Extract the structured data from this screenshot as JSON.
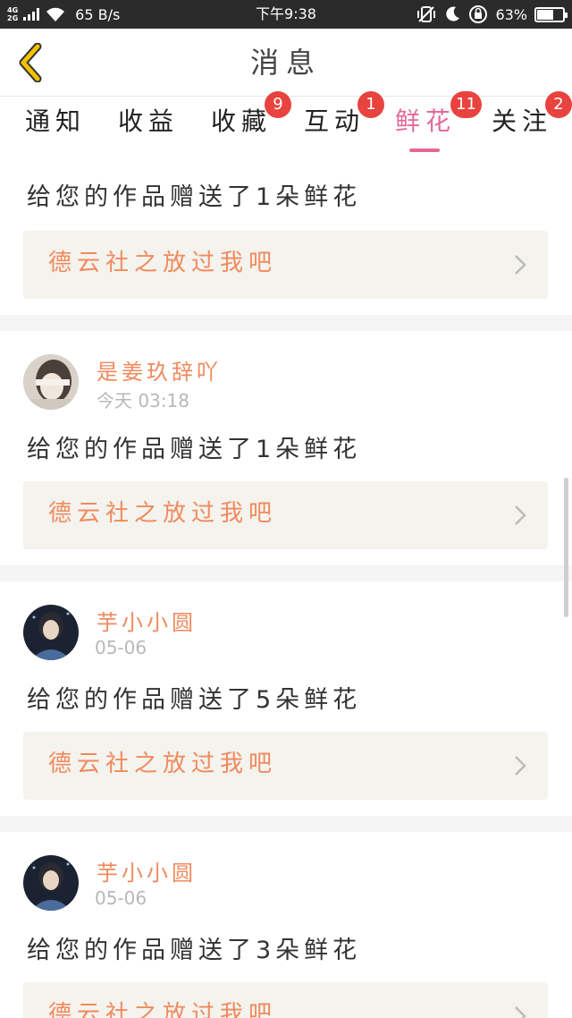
{
  "status_bar": {
    "network_top": "4G",
    "network_bottom": "2G",
    "speed": "65 B/s",
    "time": "下午9:38",
    "battery": "63%",
    "battery_level": 0.63
  },
  "header": {
    "title": "消息"
  },
  "tabs": [
    {
      "label": "通知",
      "badge": ""
    },
    {
      "label": "收益",
      "badge": ""
    },
    {
      "label": "收藏",
      "badge": "9"
    },
    {
      "label": "互动",
      "badge": "1"
    },
    {
      "label": "鲜花",
      "badge": "11"
    },
    {
      "label": "关注",
      "badge": "2"
    }
  ],
  "active_tab": "鲜花",
  "messages": [
    {
      "user": "",
      "time": "",
      "text": "给您的作品赠送了1朵鲜花",
      "work": "德云社之放过我吧"
    },
    {
      "user": "是姜玖辞吖",
      "time": "今天 03:18",
      "text": "给您的作品赠送了1朵鲜花",
      "work": "德云社之放过我吧"
    },
    {
      "user": "芋小小圆",
      "time": "05-06",
      "text": "给您的作品赠送了5朵鲜花",
      "work": "德云社之放过我吧"
    },
    {
      "user": "芋小小圆",
      "time": "05-06",
      "text": "给您的作品赠送了3朵鲜花",
      "work": "德云社之放过我吧"
    }
  ],
  "colors": {
    "accent": "#e5679a",
    "name": "#f08a5d",
    "badge": "#e8433f",
    "back_arrow": "#f2c100"
  }
}
